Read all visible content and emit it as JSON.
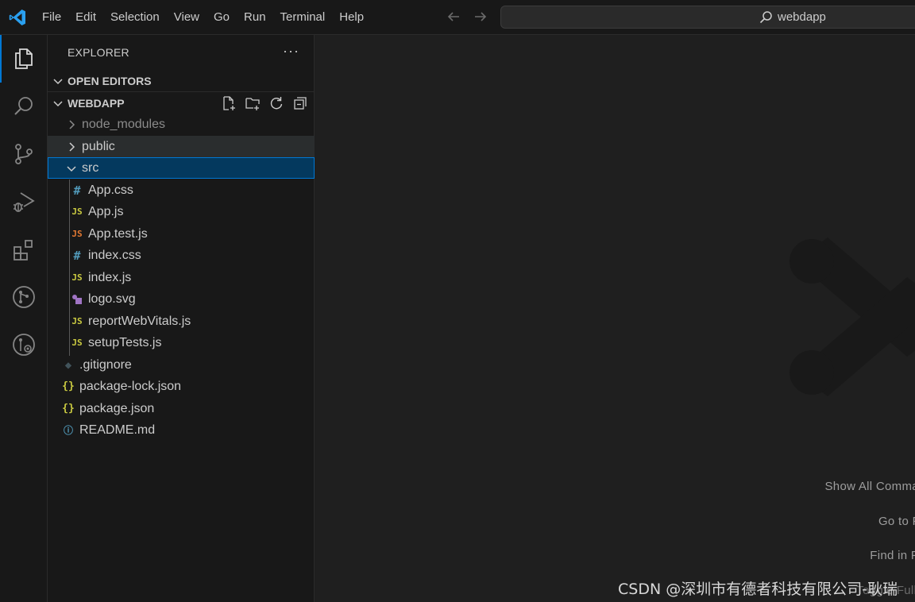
{
  "window": {
    "menu": [
      "File",
      "Edit",
      "Selection",
      "View",
      "Go",
      "Run",
      "Terminal",
      "Help"
    ],
    "search_text": "webdapp"
  },
  "activity_bar": {
    "items": [
      "explorer-icon",
      "search-icon",
      "source-control-icon",
      "run-debug-icon",
      "extensions-icon",
      "git-graph-icon",
      "gitlens-icon"
    ],
    "active": "explorer-icon"
  },
  "sidebar": {
    "title": "EXPLORER",
    "more": "···",
    "open_editors_label": "OPEN EDITORS",
    "folder_label": "WEBDAPP",
    "tree": [
      {
        "label": "node_modules",
        "type": "folder",
        "expanded": false,
        "depth": 0
      },
      {
        "label": "public",
        "type": "folder",
        "expanded": false,
        "depth": 0
      },
      {
        "label": "src",
        "type": "folder",
        "expanded": true,
        "depth": 0
      },
      {
        "label": "App.css",
        "type": "css",
        "depth": 1,
        "icon_text": "#"
      },
      {
        "label": "App.js",
        "type": "js",
        "depth": 1,
        "icon_text": "JS"
      },
      {
        "label": "App.test.js",
        "type": "jstest",
        "depth": 1,
        "icon_text": "JS"
      },
      {
        "label": "index.css",
        "type": "css",
        "depth": 1,
        "icon_text": "#"
      },
      {
        "label": "index.js",
        "type": "js",
        "depth": 1,
        "icon_text": "JS"
      },
      {
        "label": "logo.svg",
        "type": "svg",
        "depth": 1
      },
      {
        "label": "reportWebVitals.js",
        "type": "js",
        "depth": 1,
        "icon_text": "JS"
      },
      {
        "label": "setupTests.js",
        "type": "js",
        "depth": 1,
        "icon_text": "JS"
      },
      {
        "label": ".gitignore",
        "type": "git",
        "depth": 0,
        "icon_text": "◆"
      },
      {
        "label": "package-lock.json",
        "type": "json",
        "depth": 0,
        "icon_text": "{}"
      },
      {
        "label": "package.json",
        "type": "json",
        "depth": 0,
        "icon_text": "{}"
      },
      {
        "label": "README.md",
        "type": "info",
        "depth": 0,
        "icon_text": "ⓘ"
      }
    ]
  },
  "editor": {
    "shortcuts": [
      "Show All Commands",
      "Go to File",
      "Find in Files",
      "Toggle Full Screen"
    ],
    "watermark_text": "CSDN @深圳市有德者科技有限公司-耿瑞"
  },
  "colors": {
    "accent": "#0078d4",
    "selection": "#04395e"
  }
}
